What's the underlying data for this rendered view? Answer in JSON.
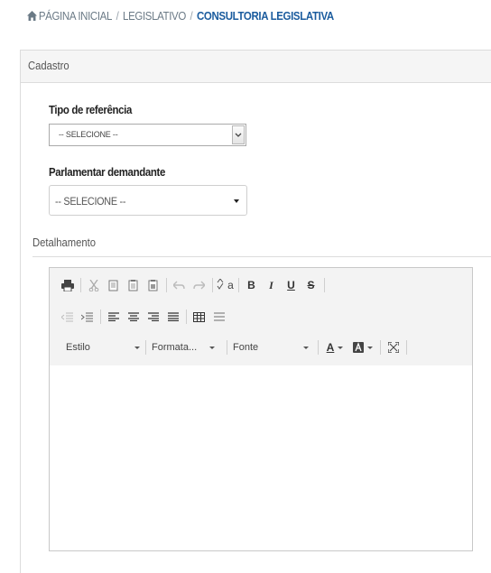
{
  "breadcrumb": {
    "home": "PÁGINA INICIAL",
    "section": "LEGISLATIVO",
    "current": "CONSULTORIA LEGISLATIVA"
  },
  "panel": {
    "title": "Cadastro"
  },
  "form": {
    "tipo_label": "Tipo de referência",
    "tipo_value": "-- SELECIONE --",
    "parlamentar_label": "Parlamentar demandante",
    "parlamentar_value": "-- SELECIONE --"
  },
  "detalhamento": {
    "title": "Detalhamento"
  },
  "editor": {
    "toolbar_row1_icons": [
      "print-icon",
      "cut-icon",
      "copy-icon",
      "paste-icon",
      "paste-text-icon",
      "undo-icon",
      "redo-icon",
      "spellcheck-icon",
      "bold-icon",
      "italic-icon",
      "underline-icon",
      "strike-icon"
    ],
    "toolbar_row2_icons": [
      "outdent-icon",
      "indent-icon",
      "align-left-icon",
      "align-center-icon",
      "align-right-icon",
      "justify-icon",
      "table-icon",
      "horizontal-rule-icon"
    ],
    "style_label": "Estilo",
    "format_label": "Formata...",
    "font_label": "Fonte",
    "bold_glyph": "B",
    "italic_glyph": "I",
    "underline_glyph": "U",
    "strike_glyph": "S",
    "text_color_glyph": "A",
    "spellcheck_glyph": "a"
  },
  "colors": {
    "breadcrumb_current": "#1b5c9e",
    "panel_heading_bg": "#f5f5f5",
    "toolbar_bg": "#f3f3f3"
  }
}
